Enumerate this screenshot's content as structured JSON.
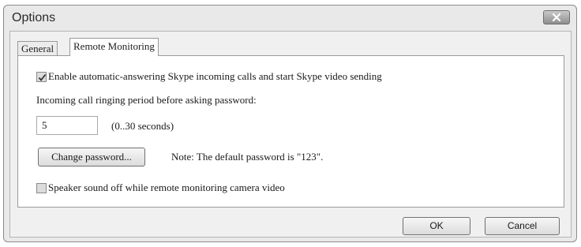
{
  "window": {
    "title": "Options"
  },
  "tabs": [
    {
      "label": "General"
    },
    {
      "label": "Remote Monitoring"
    }
  ],
  "remote_monitoring": {
    "auto_answer": {
      "label": "Enable automatic-answering Skype incoming calls and start Skype video sending",
      "checked": true
    },
    "ringing_period_label": "Incoming call ringing period before asking password:",
    "ringing_period_value": "5",
    "ringing_period_range": "(0..30 seconds)",
    "change_password_label": "Change password...",
    "password_note": "Note: The default password is \"123\".",
    "speaker_off": {
      "label": "Speaker sound off while remote monitoring camera video",
      "checked": false
    }
  },
  "footer": {
    "ok_label": "OK",
    "cancel_label": "Cancel"
  }
}
